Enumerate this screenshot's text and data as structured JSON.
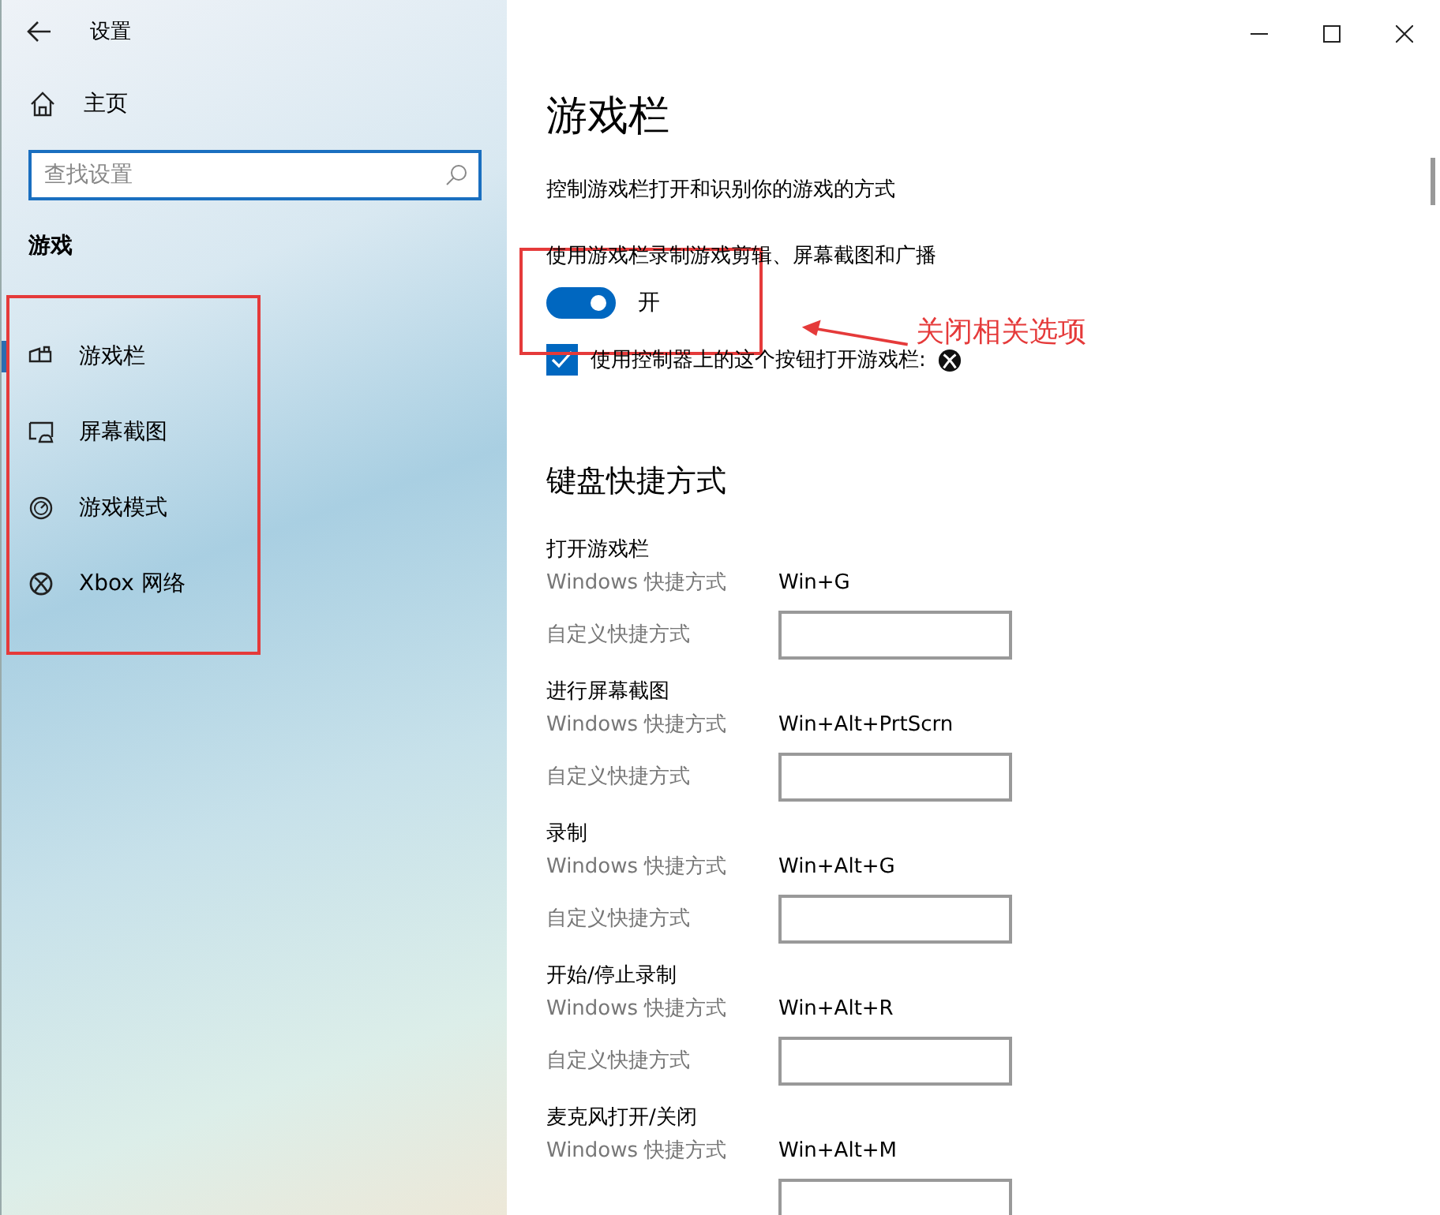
{
  "window": {
    "title": "设置"
  },
  "sidebar": {
    "home": "主页",
    "search": {
      "placeholder": "查找设置"
    },
    "section": "游戏",
    "items": [
      {
        "label": "游戏栏",
        "selected": true
      },
      {
        "label": "屏幕截图",
        "selected": false
      },
      {
        "label": "游戏模式",
        "selected": false
      },
      {
        "label": "Xbox 网络",
        "selected": false
      }
    ]
  },
  "main": {
    "title": "游戏栏",
    "description": "控制游戏栏打开和识别你的游戏的方式",
    "toggle": {
      "label": "使用游戏栏录制游戏剪辑、屏幕截图和广播",
      "on": true,
      "state_text": "开"
    },
    "checkbox": {
      "label": "使用控制器上的这个按钮打开游戏栏:",
      "checked": true
    },
    "section": "键盘快捷方式",
    "shortcuts": [
      {
        "name": "打开游戏栏",
        "windows_label": "Windows 快捷方式",
        "windows_value": "Win+G",
        "custom_label": "自定义快捷方式"
      },
      {
        "name": "进行屏幕截图",
        "windows_label": "Windows 快捷方式",
        "windows_value": "Win+Alt+PrtScrn",
        "custom_label": "自定义快捷方式"
      },
      {
        "name": "录制",
        "windows_label": "Windows 快捷方式",
        "windows_value": "Win+Alt+G",
        "custom_label": "自定义快捷方式"
      },
      {
        "name": "开始/停止录制",
        "windows_label": "Windows 快捷方式",
        "windows_value": "Win+Alt+R",
        "custom_label": "自定义快捷方式"
      },
      {
        "name": "麦克风打开/关闭",
        "windows_label": "Windows 快捷方式",
        "windows_value": "Win+Alt+M"
      }
    ]
  },
  "annotation": {
    "text": "关闭相关选项"
  }
}
